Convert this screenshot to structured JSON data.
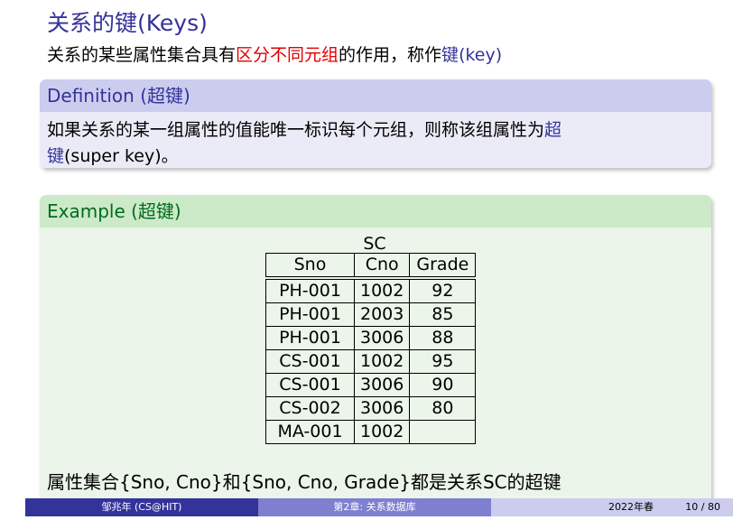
{
  "slide": {
    "title": "关系的键(Keys)",
    "intro": {
      "before": "关系的某些属性集合具有",
      "highlight": "区分不同元组",
      "middle": "的作用，称作",
      "term": "键",
      "after": "(key)"
    }
  },
  "definition": {
    "header": "Definition (超键)",
    "body_line1_text": "如果关系的某一组属性的值能唯一标识每个元组，则称该组属性为",
    "body_line1_term": "超",
    "body_line2_term": "键",
    "body_line2_rest": "(super key)。"
  },
  "example": {
    "header": "Example (超键)",
    "table": {
      "caption": "SC",
      "columns": [
        "Sno",
        "Cno",
        "Grade"
      ],
      "rows": [
        [
          "PH-001",
          "1002",
          "92"
        ],
        [
          "PH-001",
          "2003",
          "85"
        ],
        [
          "PH-001",
          "3006",
          "88"
        ],
        [
          "CS-001",
          "1002",
          "95"
        ],
        [
          "CS-001",
          "3006",
          "90"
        ],
        [
          "CS-002",
          "3006",
          "80"
        ],
        [
          "MA-001",
          "1002",
          ""
        ]
      ]
    },
    "note": "属性集合{Sno, Cno}和{Sno, Cno, Grade}都是关系SC的超键"
  },
  "footer": {
    "author": "邹兆年 (CS@HIT)",
    "chapter": "第2章: 关系数据库",
    "date": "2022年春",
    "page": "10 / 80"
  },
  "colors": {
    "title": "#33339a",
    "highlight": "#e00000",
    "definition_header": "#ccccef",
    "example_header": "#cceac8",
    "example_title": "#006b1f"
  }
}
